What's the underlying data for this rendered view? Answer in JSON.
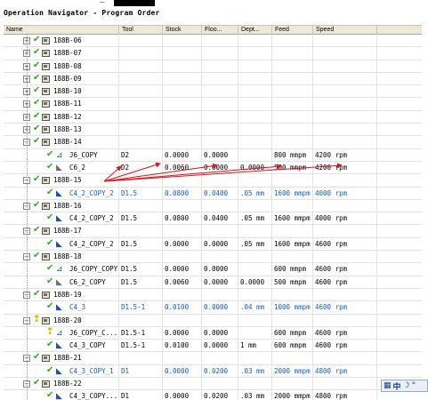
{
  "window": {
    "title": "Operation Navigator - Program Order"
  },
  "columns": [
    "Name",
    "Tool",
    "Stock",
    "Floo...",
    "Dept...",
    "Feed",
    "Speed"
  ],
  "rows": [
    {
      "type": "program",
      "name": "188B-06",
      "tool": "",
      "stock": "",
      "floor": "",
      "depth": "",
      "feed": "",
      "speed": ""
    },
    {
      "type": "program",
      "name": "188B-07",
      "tool": "",
      "stock": "",
      "floor": "",
      "depth": "",
      "feed": "",
      "speed": ""
    },
    {
      "type": "program",
      "name": "188B-08",
      "tool": "",
      "stock": "",
      "floor": "",
      "depth": "",
      "feed": "",
      "speed": ""
    },
    {
      "type": "program",
      "name": "188B-09",
      "tool": "",
      "stock": "",
      "floor": "",
      "depth": "",
      "feed": "",
      "speed": ""
    },
    {
      "type": "program",
      "name": "188B-10",
      "tool": "",
      "stock": "",
      "floor": "",
      "depth": "",
      "feed": "",
      "speed": ""
    },
    {
      "type": "program",
      "name": "188B-11",
      "tool": "",
      "stock": "",
      "floor": "",
      "depth": "",
      "feed": "",
      "speed": ""
    },
    {
      "type": "program",
      "name": "188B-12",
      "tool": "",
      "stock": "",
      "floor": "",
      "depth": "",
      "feed": "",
      "speed": ""
    },
    {
      "type": "program",
      "name": "188B-13",
      "tool": "",
      "stock": "",
      "floor": "",
      "depth": "",
      "feed": "",
      "speed": ""
    },
    {
      "type": "program-open",
      "name": "188B-14",
      "tool": "",
      "stock": "",
      "floor": "",
      "depth": "",
      "feed": "",
      "speed": ""
    },
    {
      "type": "op",
      "name": "J6_COPY",
      "tool": "D2",
      "stock": "0.0000",
      "floor": "0.0000",
      "depth": "",
      "feed": "800 mmpm",
      "speed": "4200 rpm"
    },
    {
      "type": "op-gray",
      "name": "C6_2",
      "tool": "D2",
      "stock": "0.0060",
      "floor": "0.0000",
      "depth": "0.0000",
      "feed": "500 mmpm",
      "speed": "4200 rpm"
    },
    {
      "type": "program-open",
      "name": "188B-15",
      "tool": "",
      "stock": "",
      "floor": "",
      "depth": "",
      "feed": "",
      "speed": ""
    },
    {
      "type": "op",
      "sel": true,
      "name": "C4_2_COPY_2",
      "tool": "D1.5",
      "stock": "0.0800",
      "floor": "0.0400",
      "depth": ".05 mm",
      "feed": "1600 mmpm",
      "speed": "4000 rpm"
    },
    {
      "type": "program-open",
      "name": "188B-16",
      "tool": "",
      "stock": "",
      "floor": "",
      "depth": "",
      "feed": "",
      "speed": ""
    },
    {
      "type": "op",
      "name": "C4_2_COPY_2",
      "tool": "D1.5",
      "stock": "0.0800",
      "floor": "0.0400",
      "depth": ".05 mm",
      "feed": "1600 mmpm",
      "speed": "4000 rpm"
    },
    {
      "type": "program-open",
      "name": "188B-17",
      "tool": "",
      "stock": "",
      "floor": "",
      "depth": "",
      "feed": "",
      "speed": ""
    },
    {
      "type": "op",
      "name": "C4_2_COPY_2",
      "tool": "D1.5",
      "stock": "0.0000",
      "floor": "0.0000",
      "depth": ".05 mm",
      "feed": "1600 mmpm",
      "speed": "4600 rpm"
    },
    {
      "type": "program-open",
      "name": "188B-18",
      "tool": "",
      "stock": "",
      "floor": "",
      "depth": "",
      "feed": "",
      "speed": ""
    },
    {
      "type": "op",
      "name": "J6_COPY_COPY",
      "tool": "D1.5",
      "stock": "0.0000",
      "floor": "0.0000",
      "depth": "",
      "feed": "600 mmpm",
      "speed": "4600 rpm"
    },
    {
      "type": "op-gray",
      "name": "C6_2_COPY",
      "tool": "D1.5",
      "stock": "0.0060",
      "floor": "0.0000",
      "depth": "0.0000",
      "feed": "500 mmpm",
      "speed": "4600 rpm"
    },
    {
      "type": "program-open",
      "name": "188B-19",
      "tool": "",
      "stock": "",
      "floor": "",
      "depth": "",
      "feed": "",
      "speed": ""
    },
    {
      "type": "op",
      "sel": true,
      "name": "C4_3",
      "tool": "D1.5-1",
      "stock": "0.0100",
      "floor": "0.0000",
      "depth": ".04 mm",
      "feed": "1000 mmpm",
      "speed": "4600 rpm"
    },
    {
      "type": "program-bulb",
      "name": "188B-20",
      "tool": "",
      "stock": "",
      "floor": "",
      "depth": "",
      "feed": "",
      "speed": ""
    },
    {
      "type": "op-bulb",
      "name": "J6_COPY_C...",
      "tool": "D1.5-1",
      "stock": "0.0000",
      "floor": "0.0000",
      "depth": "",
      "feed": "600 mmpm",
      "speed": "4600 rpm"
    },
    {
      "type": "op",
      "name": "C4_3_COPY",
      "tool": "D1.5-1",
      "stock": "0.0100",
      "floor": "0.0000",
      "depth": "1 mm",
      "feed": "600 mmpm",
      "speed": "4600 rpm"
    },
    {
      "type": "program-open",
      "name": "188B-21",
      "tool": "",
      "stock": "",
      "floor": "",
      "depth": "",
      "feed": "",
      "speed": ""
    },
    {
      "type": "op",
      "sel": true,
      "name": "C4_3_COPY_1",
      "tool": "D1",
      "stock": "0.0000",
      "floor": "0.0200",
      "depth": ".03 mm",
      "feed": "2000 mmpm",
      "speed": "4800 rpm"
    },
    {
      "type": "program-open",
      "name": "188B-22",
      "tool": "",
      "stock": "",
      "floor": "",
      "depth": "",
      "feed": "",
      "speed": ""
    },
    {
      "type": "op",
      "name": "C4_3_COPY...",
      "tool": "D1",
      "stock": "0.0000",
      "floor": "0.0200",
      "depth": ".03 mm",
      "feed": "2000 mmpm",
      "speed": "4800 rpm"
    }
  ],
  "ime": {
    "label_zh": "中",
    "moon": "☽",
    "dot": "°",
    "grid": "▦"
  },
  "colors": {
    "selected_text": "#1a5fb4",
    "check": "#2eaa2e",
    "annotation": "#e0141e"
  }
}
